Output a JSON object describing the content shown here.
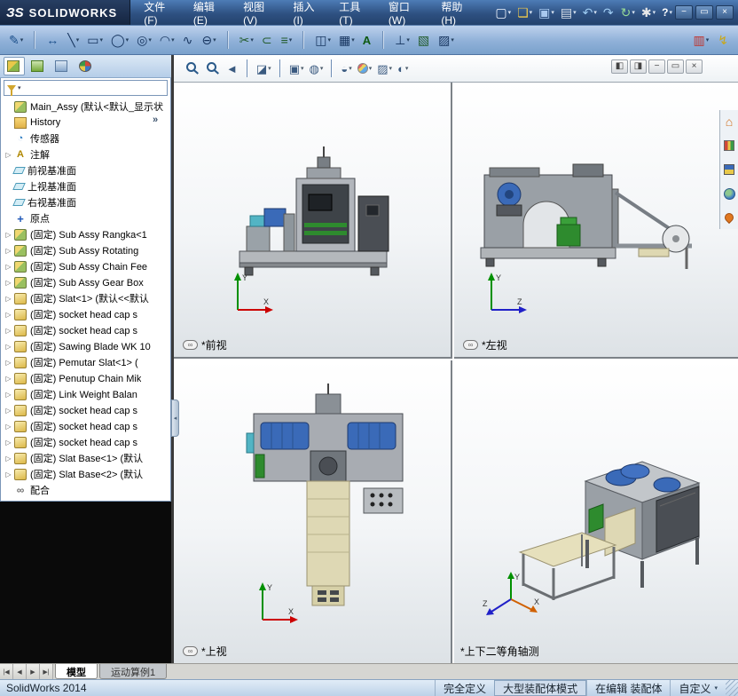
{
  "titlebar": {
    "brand_mark": "ЗS",
    "brand_name": "SOLIDWORKS",
    "menus": [
      "文件(F)",
      "编辑(E)",
      "视图(V)",
      "插入(I)",
      "工具(T)",
      "窗口(W)",
      "帮助(H)"
    ],
    "buttons": [
      {
        "name": "new-document-button",
        "glyph": "▢",
        "cls": "g-doc",
        "caret": "▾"
      },
      {
        "name": "open-button",
        "glyph": "❏",
        "cls": "g-folder",
        "caret": "▾"
      },
      {
        "name": "save-button",
        "glyph": "▣",
        "cls": "g-save",
        "caret": "▾"
      },
      {
        "name": "print-button",
        "glyph": "▤",
        "cls": "g-print",
        "caret": "▾"
      },
      {
        "name": "undo-button",
        "glyph": "↶",
        "cls": "g-undo",
        "caret": "▾"
      },
      {
        "name": "redo-button",
        "glyph": "↷",
        "cls": "g-undo",
        "caret": ""
      },
      {
        "name": "rebuild-button",
        "glyph": "↻",
        "cls": "g-rebuild",
        "caret": "▾"
      },
      {
        "name": "options-button",
        "glyph": "✱",
        "cls": "g-opts",
        "caret": "▾"
      },
      {
        "name": "help-button",
        "glyph": "?",
        "cls": "g-help",
        "caret": "▾"
      }
    ],
    "window_controls": [
      {
        "name": "minimize-button",
        "glyph": "−"
      },
      {
        "name": "maximize-button",
        "glyph": "▭"
      },
      {
        "name": "close-button",
        "glyph": "×"
      }
    ]
  },
  "sketch_toolbar": {
    "buttons": [
      {
        "name": "sketch-button",
        "glyph": "✎",
        "cls": "g-sketch",
        "caret": "▾"
      },
      {
        "name": "separator",
        "glyph": "",
        "cls": "sep",
        "caret": ""
      },
      {
        "name": "smart-dimension-button",
        "glyph": "↔",
        "cls": "g-dim",
        "caret": ""
      },
      {
        "name": "line-tool-button",
        "glyph": "╲",
        "cls": "g-tool",
        "caret": "▾"
      },
      {
        "name": "rectangle-tool-button",
        "glyph": "▭",
        "cls": "g-tool",
        "caret": "▾"
      },
      {
        "name": "circle-tool-button",
        "glyph": "◯",
        "cls": "g-tool",
        "caret": "▾"
      },
      {
        "name": "perimeter-circle-tool-button",
        "glyph": "◎",
        "cls": "g-tool",
        "caret": "▾"
      },
      {
        "name": "arc-tool-button",
        "glyph": "◠",
        "cls": "g-tool",
        "caret": "▾"
      },
      {
        "name": "spline-tool-button",
        "glyph": "∿",
        "cls": "g-tool",
        "caret": ""
      },
      {
        "name": "ellipse-tool-button",
        "glyph": "⊖",
        "cls": "g-tool",
        "caret": "▾"
      },
      {
        "name": "separator",
        "glyph": "",
        "cls": "sep",
        "caret": ""
      },
      {
        "name": "trim-entities-button",
        "glyph": "✂",
        "cls": "g-tool2",
        "caret": "▾"
      },
      {
        "name": "convert-entities-button",
        "glyph": "⊂",
        "cls": "g-tool2",
        "caret": ""
      },
      {
        "name": "offset-entities-button",
        "glyph": "≡",
        "cls": "g-tool2",
        "caret": "▾"
      },
      {
        "name": "separator",
        "glyph": "",
        "cls": "sep",
        "caret": ""
      },
      {
        "name": "mirror-entities-button",
        "glyph": "◫",
        "cls": "g-tool",
        "caret": "▾"
      },
      {
        "name": "linear-pattern-button",
        "glyph": "▦",
        "cls": "g-tool",
        "caret": "▾"
      },
      {
        "name": "text-tool-button",
        "glyph": "A",
        "cls": "g-text",
        "caret": ""
      },
      {
        "name": "separator",
        "glyph": "",
        "cls": "sep",
        "caret": ""
      },
      {
        "name": "display-relations-button",
        "glyph": "⊥",
        "cls": "g-tool",
        "caret": "▾"
      },
      {
        "name": "repair-sketch-button",
        "glyph": "▧",
        "cls": "g-tool2",
        "caret": ""
      },
      {
        "name": "quick-snaps-button",
        "glyph": "▨",
        "cls": "g-tool",
        "caret": "▾"
      }
    ],
    "right_buttons": [
      {
        "name": "toolbox-button",
        "glyph": "▥",
        "cls": "g-toolbox",
        "caret": "▾"
      },
      {
        "name": "macro-button",
        "glyph": "↯",
        "cls": "g-macro",
        "caret": ""
      }
    ]
  },
  "feature_tree": {
    "panel_tabs": [
      {
        "name": "featuremanager-tab",
        "cls": "fm-icon",
        "active": "active"
      },
      {
        "name": "propertymanager-tab",
        "cls": "pm-icon",
        "active": ""
      },
      {
        "name": "configurationmanager-tab",
        "cls": "cm-icon",
        "active": ""
      },
      {
        "name": "dimxpert-tab",
        "cls": "dx-icon",
        "active": ""
      }
    ],
    "panel_tabs_overflow": "»",
    "root": {
      "icon": "assembly-icon",
      "label": "Main_Assy (默认<默认_显示状"
    },
    "items": [
      {
        "arrow": "",
        "icon": "history-icon",
        "label": "History"
      },
      {
        "arrow": "",
        "icon": "sensors-icon",
        "label": "传感器"
      },
      {
        "arrow": "▷",
        "icon": "annotations-icon",
        "label": "注解"
      },
      {
        "arrow": "",
        "icon": "plane-icon",
        "label": "前视基准面"
      },
      {
        "arrow": "",
        "icon": "plane-icon",
        "label": "上视基准面"
      },
      {
        "arrow": "",
        "icon": "plane-icon",
        "label": "右视基准面"
      },
      {
        "arrow": "",
        "icon": "origin-icon",
        "label": "原点"
      },
      {
        "arrow": "▷",
        "icon": "subassembly-icon",
        "label": "(固定) Sub Assy Rangka<1"
      },
      {
        "arrow": "▷",
        "icon": "subassembly-icon",
        "label": "(固定) Sub Assy Rotating"
      },
      {
        "arrow": "▷",
        "icon": "subassembly-icon",
        "label": "(固定) Sub Assy Chain Fee"
      },
      {
        "arrow": "▷",
        "icon": "subassembly-icon",
        "label": "(固定) Sub Assy Gear Box"
      },
      {
        "arrow": "▷",
        "icon": "part-icon",
        "label": "(固定) Slat<1> (默认<<默认"
      },
      {
        "arrow": "▷",
        "icon": "part-icon",
        "label": "(固定) socket head cap s"
      },
      {
        "arrow": "▷",
        "icon": "part-icon",
        "label": "(固定) socket head cap s"
      },
      {
        "arrow": "▷",
        "icon": "part-icon",
        "label": "(固定) Sawing Blade WK 10"
      },
      {
        "arrow": "▷",
        "icon": "part-icon",
        "label": "(固定) Pemutar Slat<1> ("
      },
      {
        "arrow": "▷",
        "icon": "part-icon",
        "label": "(固定) Penutup Chain Mik"
      },
      {
        "arrow": "▷",
        "icon": "part-icon",
        "label": "(固定) Link Weight Balan"
      },
      {
        "arrow": "▷",
        "icon": "part-icon",
        "label": "(固定) socket head cap s"
      },
      {
        "arrow": "▷",
        "icon": "part-icon",
        "label": "(固定) socket head cap s"
      },
      {
        "arrow": "▷",
        "icon": "part-icon",
        "label": "(固定) socket head cap s"
      },
      {
        "arrow": "▷",
        "icon": "part-icon",
        "label": "(固定) Slat Base<1> (默认"
      },
      {
        "arrow": "▷",
        "icon": "part-icon",
        "label": "(固定) Slat Base<2> (默认"
      },
      {
        "arrow": "",
        "icon": "mates-icon",
        "label": "配合"
      }
    ]
  },
  "view_toolbar": {
    "buttons": [
      {
        "name": "zoom-fit-button",
        "glyph": "",
        "cls": "mag-icon",
        "caret": ""
      },
      {
        "name": "zoom-area-button",
        "glyph": "",
        "cls": "mag-icon",
        "caret": ""
      },
      {
        "name": "previous-view-button",
        "glyph": "◄",
        "cls": "g-hu",
        "caret": ""
      },
      {
        "name": "separator",
        "glyph": "",
        "cls": "sep",
        "caret": ""
      },
      {
        "name": "section-view-button",
        "glyph": "◪",
        "cls": "g-hu",
        "caret": "▾"
      },
      {
        "name": "separator",
        "glyph": "",
        "cls": "sep",
        "caret": ""
      },
      {
        "name": "view-orientation-button",
        "glyph": "▣",
        "cls": "g-hu",
        "caret": "▾"
      },
      {
        "name": "display-style-button",
        "glyph": "◍",
        "cls": "g-hu",
        "caret": "▾"
      },
      {
        "name": "separator",
        "glyph": "",
        "cls": "sep",
        "caret": ""
      },
      {
        "name": "hide-show-items-button",
        "glyph": "◒",
        "cls": "g-hu",
        "caret": "▾"
      },
      {
        "name": "edit-appearance-button",
        "glyph": "",
        "cls": "sphere-icon",
        "caret": "▾"
      },
      {
        "name": "apply-scene-button",
        "glyph": "▨",
        "cls": "g-hu",
        "caret": "▾"
      },
      {
        "name": "view-settings-button",
        "glyph": "◐",
        "cls": "g-hu",
        "caret": "▾"
      }
    ],
    "window_buttons": [
      {
        "name": "dock-left-button",
        "glyph": "◧"
      },
      {
        "name": "dock-right-button",
        "glyph": "◨"
      },
      {
        "name": "minimize-view-button",
        "glyph": "−"
      },
      {
        "name": "restore-view-button",
        "glyph": "▭"
      },
      {
        "name": "close-view-button",
        "glyph": "×"
      }
    ]
  },
  "task_pane": [
    {
      "name": "home-tab",
      "glyph": "⌂",
      "cls": "g-home"
    },
    {
      "name": "design-library-tab",
      "glyph": "",
      "cls": "chart-icon"
    },
    {
      "name": "file-explorer-tab",
      "glyph": "",
      "cls": "lib-icon"
    },
    {
      "name": "solidworks-resources-tab",
      "glyph": "",
      "cls": "globe-icon"
    },
    {
      "name": "custom-properties-tab",
      "glyph": "",
      "cls": "pin-icon"
    }
  ],
  "viewports": [
    {
      "name": "viewport-front",
      "label": "*前视",
      "axis_v": "Y",
      "axis_h": "X"
    },
    {
      "name": "viewport-left",
      "label": "*左视",
      "axis_v": "Y",
      "axis_h": "Z"
    },
    {
      "name": "viewport-top",
      "label": "*上视",
      "axis_v": "Y",
      "axis_h": "X"
    },
    {
      "name": "viewport-isometric",
      "label": "*上下二等角轴测",
      "axis_v": "Y",
      "axis_h": "X",
      "axis_d": "Z"
    }
  ],
  "bottom_bar": {
    "nav_buttons": [
      {
        "name": "first-tab-button",
        "glyph": "|◀"
      },
      {
        "name": "prev-tab-button",
        "glyph": "◀"
      },
      {
        "name": "next-tab-button",
        "glyph": "▶"
      },
      {
        "name": "last-tab-button",
        "glyph": "▶|"
      }
    ],
    "tabs": [
      {
        "label": "模型",
        "cls": "active"
      },
      {
        "label": "运动算例1",
        "cls": ""
      }
    ]
  },
  "statusbar": {
    "app_version": "SolidWorks 2014",
    "definition_status": "完全定义",
    "assembly_mode": "大型装配体模式",
    "edit_status": "在编辑 装配体",
    "units": "自定义"
  }
}
